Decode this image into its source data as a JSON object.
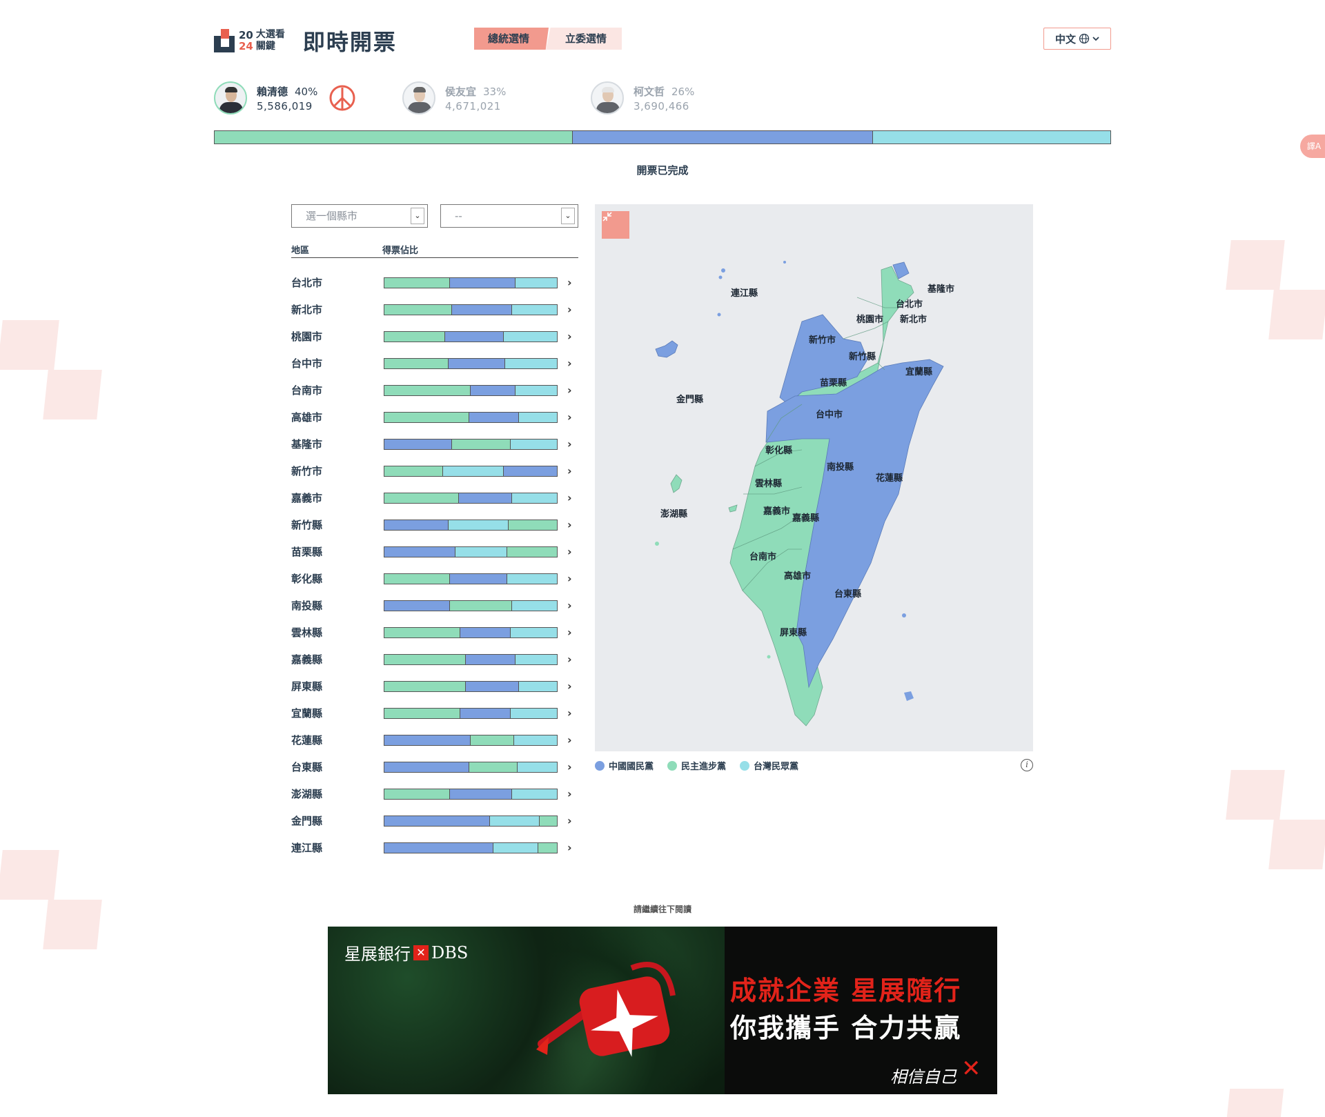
{
  "header": {
    "logo_year_top": "20",
    "logo_year_bottom": "24",
    "logo_sub": "大選看關鍵",
    "title": "即時開票",
    "tabs": [
      {
        "label": "總統選情",
        "active": true
      },
      {
        "label": "立委選情",
        "active": false
      }
    ],
    "language": "中文"
  },
  "candidates": [
    {
      "name": "賴清德",
      "pct": "40%",
      "votes": "5,586,019",
      "winner": true
    },
    {
      "name": "侯友宜",
      "pct": "33%",
      "votes": "4,671,021",
      "winner": false
    },
    {
      "name": "柯文哲",
      "pct": "26%",
      "votes": "3,690,466",
      "winner": false
    }
  ],
  "overall_shares": {
    "dpp": 0.4,
    "kmt": 0.335,
    "tpp": 0.265
  },
  "status": "開票已完成",
  "filters": {
    "county_placeholder": "選一個縣市",
    "district_placeholder": "--"
  },
  "table": {
    "col_region": "地區",
    "col_share": "得票佔比"
  },
  "colors": {
    "kmt": "#7b9fe0",
    "dpp": "#8fdcb9",
    "tpp": "#96dfe8"
  },
  "regions": [
    {
      "name": "台北市",
      "segments": [
        [
          "dpp",
          0.38
        ],
        [
          "kmt",
          0.38
        ],
        [
          "tpp",
          0.24
        ]
      ]
    },
    {
      "name": "新北市",
      "segments": [
        [
          "dpp",
          0.39
        ],
        [
          "kmt",
          0.35
        ],
        [
          "tpp",
          0.26
        ]
      ]
    },
    {
      "name": "桃園市",
      "segments": [
        [
          "dpp",
          0.35
        ],
        [
          "kmt",
          0.34
        ],
        [
          "tpp",
          0.31
        ]
      ]
    },
    {
      "name": "台中市",
      "segments": [
        [
          "dpp",
          0.37
        ],
        [
          "kmt",
          0.33
        ],
        [
          "tpp",
          0.3
        ]
      ]
    },
    {
      "name": "台南市",
      "segments": [
        [
          "dpp",
          0.5
        ],
        [
          "kmt",
          0.26
        ],
        [
          "tpp",
          0.24
        ]
      ]
    },
    {
      "name": "高雄市",
      "segments": [
        [
          "dpp",
          0.49
        ],
        [
          "kmt",
          0.29
        ],
        [
          "tpp",
          0.22
        ]
      ]
    },
    {
      "name": "基隆市",
      "segments": [
        [
          "kmt",
          0.39
        ],
        [
          "dpp",
          0.34
        ],
        [
          "tpp",
          0.27
        ]
      ]
    },
    {
      "name": "新竹市",
      "segments": [
        [
          "dpp",
          0.34
        ],
        [
          "tpp",
          0.35
        ],
        [
          "kmt",
          0.31
        ]
      ]
    },
    {
      "name": "嘉義市",
      "segments": [
        [
          "dpp",
          0.43
        ],
        [
          "kmt",
          0.31
        ],
        [
          "tpp",
          0.26
        ]
      ]
    },
    {
      "name": "新竹縣",
      "segments": [
        [
          "kmt",
          0.37
        ],
        [
          "tpp",
          0.35
        ],
        [
          "dpp",
          0.28
        ]
      ]
    },
    {
      "name": "苗栗縣",
      "segments": [
        [
          "kmt",
          0.41
        ],
        [
          "tpp",
          0.3
        ],
        [
          "dpp",
          0.29
        ]
      ]
    },
    {
      "name": "彰化縣",
      "segments": [
        [
          "dpp",
          0.38
        ],
        [
          "kmt",
          0.33
        ],
        [
          "tpp",
          0.29
        ]
      ]
    },
    {
      "name": "南投縣",
      "segments": [
        [
          "kmt",
          0.38
        ],
        [
          "dpp",
          0.36
        ],
        [
          "tpp",
          0.26
        ]
      ]
    },
    {
      "name": "雲林縣",
      "segments": [
        [
          "dpp",
          0.44
        ],
        [
          "kmt",
          0.29
        ],
        [
          "tpp",
          0.27
        ]
      ]
    },
    {
      "name": "嘉義縣",
      "segments": [
        [
          "dpp",
          0.47
        ],
        [
          "kmt",
          0.29
        ],
        [
          "tpp",
          0.24
        ]
      ]
    },
    {
      "name": "屏東縣",
      "segments": [
        [
          "dpp",
          0.47
        ],
        [
          "kmt",
          0.31
        ],
        [
          "tpp",
          0.22
        ]
      ]
    },
    {
      "name": "宜蘭縣",
      "segments": [
        [
          "dpp",
          0.44
        ],
        [
          "kmt",
          0.29
        ],
        [
          "tpp",
          0.27
        ]
      ]
    },
    {
      "name": "花蓮縣",
      "segments": [
        [
          "kmt",
          0.5
        ],
        [
          "dpp",
          0.25
        ],
        [
          "tpp",
          0.25
        ]
      ]
    },
    {
      "name": "台東縣",
      "segments": [
        [
          "kmt",
          0.49
        ],
        [
          "dpp",
          0.28
        ],
        [
          "tpp",
          0.23
        ]
      ]
    },
    {
      "name": "澎湖縣",
      "segments": [
        [
          "dpp",
          0.38
        ],
        [
          "kmt",
          0.36
        ],
        [
          "tpp",
          0.26
        ]
      ]
    },
    {
      "name": "金門縣",
      "segments": [
        [
          "kmt",
          0.61
        ],
        [
          "tpp",
          0.29
        ],
        [
          "dpp",
          0.1
        ]
      ]
    },
    {
      "name": "連江縣",
      "segments": [
        [
          "kmt",
          0.63
        ],
        [
          "tpp",
          0.26
        ],
        [
          "dpp",
          0.11
        ]
      ]
    }
  ],
  "map_labels": [
    "連江縣",
    "基隆市",
    "台北市",
    "桃園市",
    "新北市",
    "新竹市",
    "新竹縣",
    "宜蘭縣",
    "苗栗縣",
    "金門縣",
    "台中市",
    "彰化縣",
    "南投縣",
    "花蓮縣",
    "雲林縣",
    "澎湖縣",
    "嘉義市",
    "嘉義縣",
    "台南市",
    "高雄市",
    "台東縣",
    "屏東縣"
  ],
  "legend": [
    {
      "label": "中國國民黨",
      "color": "#7b9fe0"
    },
    {
      "label": "民主進步黨",
      "color": "#8fdcb9"
    },
    {
      "label": "台灣民眾黨",
      "color": "#96dfe8"
    }
  ],
  "read_more": "請繼續往下閱讀",
  "ad": {
    "brand": "星展銀行",
    "brand_en": "DBS",
    "line1": "成就企業 星展隨行",
    "line2": "你我攜手 合力共贏",
    "signature": "相信自己"
  },
  "side_tab": "譯A"
}
